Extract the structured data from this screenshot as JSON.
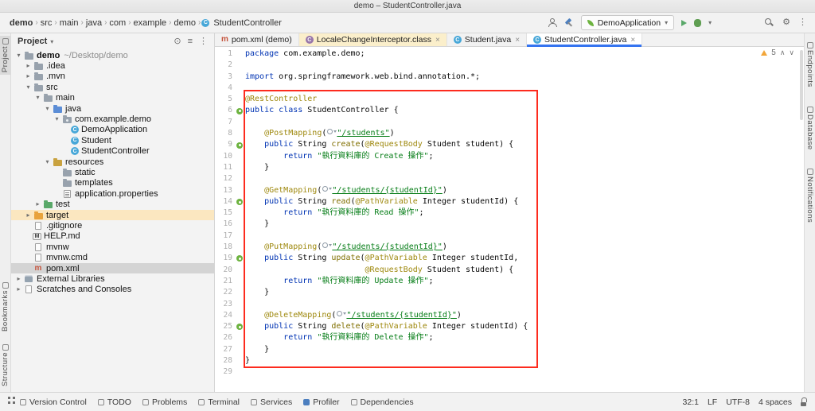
{
  "window": {
    "title": "demo – StudentController.java"
  },
  "breadcrumbs": [
    "demo",
    "src",
    "main",
    "java",
    "com",
    "example",
    "demo",
    "StudentController"
  ],
  "toolbar": {
    "run_config": "DemoApplication"
  },
  "tabs": [
    {
      "label": "pom.xml (demo)",
      "icon": "maven",
      "close": false,
      "state": "normal"
    },
    {
      "label": "LocaleChangeInterceptor.class",
      "icon": "class-purple",
      "close": true,
      "state": "warn"
    },
    {
      "label": "Student.java",
      "icon": "class",
      "close": true,
      "state": "normal"
    },
    {
      "label": "StudentController.java",
      "icon": "class",
      "close": true,
      "state": "active"
    }
  ],
  "project": {
    "header": "Project",
    "tree": [
      {
        "label": "demo",
        "note": "~/Desktop/demo",
        "indent": 0,
        "chev": "open",
        "icon": "folder",
        "bold": true
      },
      {
        "label": ".idea",
        "indent": 1,
        "chev": "closed",
        "icon": "folder"
      },
      {
        "label": ".mvn",
        "indent": 1,
        "chev": "closed",
        "icon": "folder"
      },
      {
        "label": "src",
        "indent": 1,
        "chev": "open",
        "icon": "folder"
      },
      {
        "label": "main",
        "indent": 2,
        "chev": "open",
        "icon": "folder"
      },
      {
        "label": "java",
        "indent": 3,
        "chev": "open",
        "icon": "folder-blue"
      },
      {
        "label": "com.example.demo",
        "indent": 4,
        "chev": "open",
        "icon": "package"
      },
      {
        "label": "DemoApplication",
        "indent": 5,
        "chev": "none",
        "icon": "class"
      },
      {
        "label": "Student",
        "indent": 5,
        "chev": "none",
        "icon": "class"
      },
      {
        "label": "StudentController",
        "indent": 5,
        "chev": "none",
        "icon": "class"
      },
      {
        "label": "resources",
        "indent": 3,
        "chev": "open",
        "icon": "folder-res"
      },
      {
        "label": "static",
        "indent": 4,
        "chev": "none",
        "icon": "folder"
      },
      {
        "label": "templates",
        "indent": 4,
        "chev": "none",
        "icon": "folder"
      },
      {
        "label": "application.properties",
        "indent": 4,
        "chev": "none",
        "icon": "props"
      },
      {
        "label": "test",
        "indent": 2,
        "chev": "closed",
        "icon": "folder-green"
      },
      {
        "label": "target",
        "indent": 1,
        "chev": "closed",
        "icon": "folder-orange",
        "state": "excluded"
      },
      {
        "label": ".gitignore",
        "indent": 1,
        "chev": "none",
        "icon": "file"
      },
      {
        "label": "HELP.md",
        "indent": 1,
        "chev": "none",
        "icon": "file-md"
      },
      {
        "label": "mvnw",
        "indent": 1,
        "chev": "none",
        "icon": "file"
      },
      {
        "label": "mvnw.cmd",
        "indent": 1,
        "chev": "none",
        "icon": "file"
      },
      {
        "label": "pom.xml",
        "indent": 1,
        "chev": "none",
        "icon": "maven",
        "state": "selected"
      },
      {
        "label": "External Libraries",
        "indent": 0,
        "chev": "closed",
        "icon": "lib"
      },
      {
        "label": "Scratches and Consoles",
        "indent": 0,
        "chev": "closed",
        "icon": "scratch"
      }
    ]
  },
  "editor": {
    "inspections": {
      "warnings": "5"
    },
    "lines": [
      {
        "g": null,
        "t": [
          [
            "k",
            "package"
          ],
          [
            "p",
            " com.example.demo;"
          ]
        ]
      },
      {
        "g": null,
        "t": []
      },
      {
        "g": null,
        "t": [
          [
            "k",
            "import"
          ],
          [
            "p",
            " org.springframework.web.bind.annotation.*;"
          ]
        ]
      },
      {
        "g": null,
        "t": []
      },
      {
        "g": null,
        "t": [
          [
            "a",
            "@RestController"
          ]
        ]
      },
      {
        "g": "bean",
        "t": [
          [
            "k",
            "public"
          ],
          [
            "p",
            " "
          ],
          [
            "k",
            "class"
          ],
          [
            "p",
            " StudentController {"
          ]
        ]
      },
      {
        "g": null,
        "t": []
      },
      {
        "g": null,
        "t": [
          [
            "p",
            "    "
          ],
          [
            "a",
            "@PostMapping"
          ],
          [
            "p",
            "("
          ],
          [
            "i",
            ""
          ],
          [
            "u",
            "\"/students\""
          ],
          [
            "p",
            ")"
          ]
        ]
      },
      {
        "g": "map",
        "t": [
          [
            "p",
            "    "
          ],
          [
            "k",
            "public"
          ],
          [
            "p",
            " String "
          ],
          [
            "m",
            "create"
          ],
          [
            "p",
            "("
          ],
          [
            "a",
            "@RequestBody"
          ],
          [
            "p",
            " Student student) {"
          ]
        ]
      },
      {
        "g": null,
        "t": [
          [
            "p",
            "        "
          ],
          [
            "k",
            "return"
          ],
          [
            "p",
            " "
          ],
          [
            "s",
            "\"執行資料庫的 Create 操作\""
          ],
          [
            "p",
            ";"
          ]
        ]
      },
      {
        "g": null,
        "t": [
          [
            "p",
            "    }"
          ]
        ]
      },
      {
        "g": null,
        "t": []
      },
      {
        "g": null,
        "t": [
          [
            "p",
            "    "
          ],
          [
            "a",
            "@GetMapping"
          ],
          [
            "p",
            "("
          ],
          [
            "i",
            ""
          ],
          [
            "u",
            "\"/students/{studentId}\""
          ],
          [
            "p",
            ")"
          ]
        ]
      },
      {
        "g": "map",
        "t": [
          [
            "p",
            "    "
          ],
          [
            "k",
            "public"
          ],
          [
            "p",
            " String "
          ],
          [
            "m",
            "read"
          ],
          [
            "p",
            "("
          ],
          [
            "a",
            "@PathVariable"
          ],
          [
            "p",
            " Integer studentId) {"
          ]
        ]
      },
      {
        "g": null,
        "t": [
          [
            "p",
            "        "
          ],
          [
            "k",
            "return"
          ],
          [
            "p",
            " "
          ],
          [
            "s",
            "\"執行資料庫的 Read 操作\""
          ],
          [
            "p",
            ";"
          ]
        ]
      },
      {
        "g": null,
        "t": [
          [
            "p",
            "    }"
          ]
        ]
      },
      {
        "g": null,
        "t": []
      },
      {
        "g": null,
        "t": [
          [
            "p",
            "    "
          ],
          [
            "a",
            "@PutMapping"
          ],
          [
            "p",
            "("
          ],
          [
            "i",
            ""
          ],
          [
            "u",
            "\"/students/{studentId}\""
          ],
          [
            "p",
            ")"
          ]
        ]
      },
      {
        "g": "map",
        "t": [
          [
            "p",
            "    "
          ],
          [
            "k",
            "public"
          ],
          [
            "p",
            " String "
          ],
          [
            "m",
            "update"
          ],
          [
            "p",
            "("
          ],
          [
            "a",
            "@PathVariable"
          ],
          [
            "p",
            " Integer studentId,"
          ]
        ]
      },
      {
        "g": null,
        "t": [
          [
            "p",
            "                         "
          ],
          [
            "a",
            "@RequestBody"
          ],
          [
            "p",
            " Student student) {"
          ]
        ]
      },
      {
        "g": null,
        "t": [
          [
            "p",
            "        "
          ],
          [
            "k",
            "return"
          ],
          [
            "p",
            " "
          ],
          [
            "s",
            "\"執行資料庫的 Update 操作\""
          ],
          [
            "p",
            ";"
          ]
        ]
      },
      {
        "g": null,
        "t": [
          [
            "p",
            "    }"
          ]
        ]
      },
      {
        "g": null,
        "t": []
      },
      {
        "g": null,
        "t": [
          [
            "p",
            "    "
          ],
          [
            "a",
            "@DeleteMapping"
          ],
          [
            "p",
            "("
          ],
          [
            "i",
            ""
          ],
          [
            "u",
            "\"/students/{studentId}\""
          ],
          [
            "p",
            ")"
          ]
        ]
      },
      {
        "g": "map",
        "t": [
          [
            "p",
            "    "
          ],
          [
            "k",
            "public"
          ],
          [
            "p",
            " String "
          ],
          [
            "m",
            "delete"
          ],
          [
            "p",
            "("
          ],
          [
            "a",
            "@PathVariable"
          ],
          [
            "p",
            " Integer studentId) {"
          ]
        ]
      },
      {
        "g": null,
        "t": [
          [
            "p",
            "        "
          ],
          [
            "k",
            "return"
          ],
          [
            "p",
            " "
          ],
          [
            "s",
            "\"執行資料庫的 Delete 操作\""
          ],
          [
            "p",
            ";"
          ]
        ]
      },
      {
        "g": null,
        "t": [
          [
            "p",
            "    }"
          ]
        ]
      },
      {
        "g": null,
        "t": [
          [
            "p",
            "}"
          ]
        ]
      },
      {
        "g": null,
        "t": []
      }
    ]
  },
  "stripes": {
    "left": [
      {
        "label": "Project",
        "icon": "project",
        "active": true
      },
      {
        "label": "Bookmarks",
        "icon": "bookmarks"
      },
      {
        "label": "Structure",
        "icon": "structure"
      }
    ],
    "right": [
      {
        "label": "Endpoints",
        "icon": "endpoints"
      },
      {
        "label": "Database",
        "icon": "database"
      },
      {
        "label": "Notifications",
        "icon": "notifications"
      }
    ]
  },
  "status": {
    "left": [
      {
        "label": "Version Control",
        "icon": "vcs"
      },
      {
        "label": "TODO",
        "icon": "todo"
      },
      {
        "label": "Problems",
        "icon": "problems"
      },
      {
        "label": "Terminal",
        "icon": "terminal"
      },
      {
        "label": "Services",
        "icon": "services"
      },
      {
        "label": "Profiler",
        "icon": "profiler"
      },
      {
        "label": "Dependencies",
        "icon": "dependencies"
      }
    ],
    "right": [
      {
        "label": "32:1",
        "name": "caret-position"
      },
      {
        "label": "LF",
        "name": "line-separator"
      },
      {
        "label": "UTF-8",
        "name": "encoding"
      },
      {
        "label": "4 spaces",
        "name": "indent-style"
      }
    ]
  },
  "colors": {
    "accent": "#3574F0",
    "keyword": "#0033B3",
    "annotation": "#9E880D",
    "string": "#067D17",
    "method": "#806F00",
    "annotation_box": "#FD2B1E",
    "warning": "#F2A63A",
    "spring_green": "#6DB33F"
  }
}
